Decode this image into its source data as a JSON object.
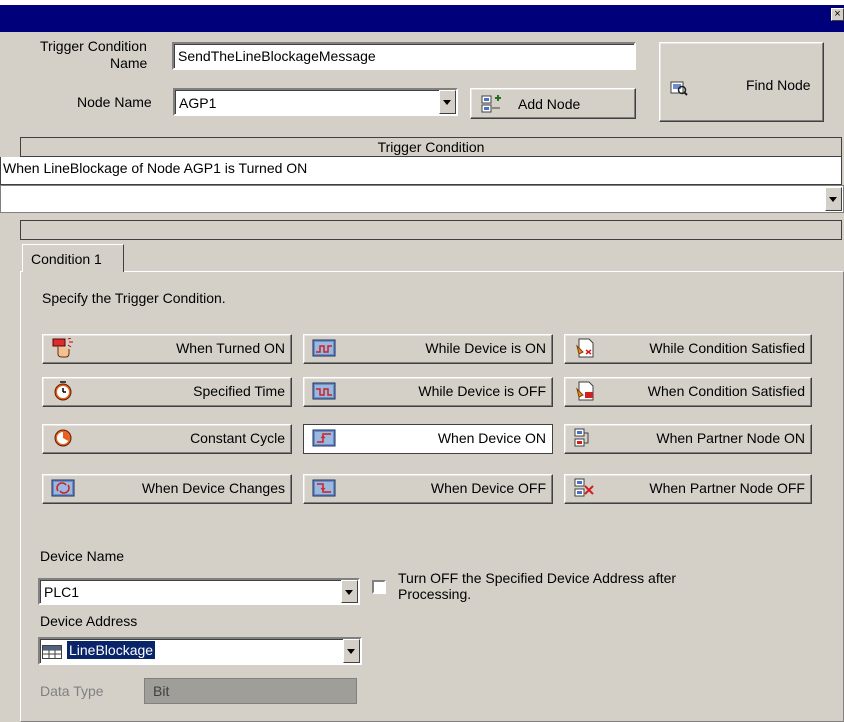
{
  "window": {
    "close_glyph": "×"
  },
  "trigger_condition_name": {
    "label_line1": "Trigger Condition",
    "label_line2": "Name",
    "value": "SendTheLineBlockageMessage"
  },
  "node": {
    "label": "Node Name",
    "value": "AGP1",
    "add_node_label": "Add Node",
    "find_node_label": "Find Node"
  },
  "trigger_condition": {
    "header": "Trigger Condition",
    "summary": "When LineBlockage of Node AGP1 is Turned ON",
    "dropdown_value": ""
  },
  "tabs": [
    {
      "label": "Condition 1",
      "active": true
    }
  ],
  "condition": {
    "instruction": "Specify the Trigger Condition.",
    "buttons": [
      {
        "label": "When Turned ON",
        "icon": "touch-hand-icon"
      },
      {
        "label": "While Device is ON",
        "icon": "device-on-wave-icon"
      },
      {
        "label": "While Condition Satisfied",
        "icon": "condition-satisfied-icon"
      },
      {
        "label": "Specified Time",
        "icon": "alarm-clock-icon"
      },
      {
        "label": "While Device is OFF",
        "icon": "device-off-wave-icon"
      },
      {
        "label": "When Condition Satisfied",
        "icon": "condition-ok-icon"
      },
      {
        "label": "Constant Cycle",
        "icon": "cycle-timer-icon"
      },
      {
        "label": "When Device ON",
        "icon": "device-rise-icon",
        "selected": true
      },
      {
        "label": "When Partner Node ON",
        "icon": "partner-node-on-icon"
      },
      {
        "label": "When Device Changes",
        "icon": "device-change-icon"
      },
      {
        "label": "When Device OFF",
        "icon": "device-fall-icon"
      },
      {
        "label": "When Partner Node OFF",
        "icon": "partner-node-off-icon"
      }
    ]
  },
  "device": {
    "name_label": "Device Name",
    "name_value": "PLC1",
    "turn_off_label_line1": "Turn OFF the Specified Device Address after",
    "turn_off_label_line2": "Processing.",
    "turn_off_checked": false,
    "address_label": "Device Address",
    "address_value": "LineBlockage",
    "data_type_label": "Data Type",
    "data_type_value": "Bit"
  },
  "colors": {
    "titlebar": "#00007a",
    "face": "#d4d0c8",
    "selection": "#0a246a"
  }
}
